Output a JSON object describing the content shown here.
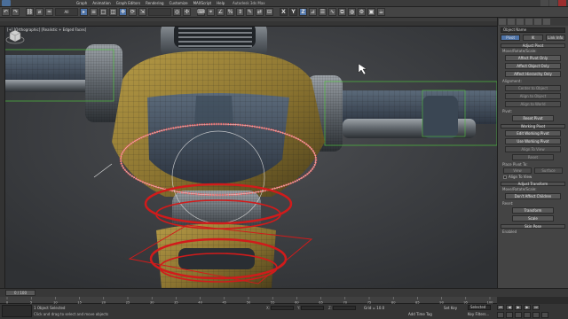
{
  "menubar": {
    "items": [
      "Graph",
      "Animation",
      "Graph Editors",
      "Rendering",
      "Customize",
      "MAXScript",
      "Help"
    ],
    "window_title": "Autodesk 3ds Max"
  },
  "toolbar": {
    "filter": "All",
    "axis_x": "X",
    "axis_y": "Y",
    "axis_z": "Z"
  },
  "viewport": {
    "label": "[+] [Orthographic] [Realistic + Edged Faces]"
  },
  "command_panel": {
    "name_field": "Object Name",
    "tabs": [
      "Pivot",
      "IK",
      "Link Info"
    ],
    "adjust_pivot": {
      "header": "Adjust Pivot",
      "move_rotate_scale": "Move/Rotate/Scale:",
      "btn_pivot_only": "Affect Pivot Only",
      "btn_object_only": "Affect Object Only",
      "btn_hierarchy_only": "Affect Hierarchy Only"
    },
    "alignment": {
      "header": "Alignment:",
      "btn_center": "Center to Object",
      "btn_align": "Align to Object",
      "btn_world": "Align to World"
    },
    "pivot": {
      "header": "Pivot:",
      "btn_reset": "Reset Pivot"
    },
    "working_pivot": {
      "header": "Working Pivot",
      "btn_edit": "Edit Working Pivot",
      "btn_use": "Use Working Pivot",
      "btn_align_view": "Align To View",
      "btn_reset": "Reset",
      "place_label": "Place Pivot To:",
      "btn_view": "View",
      "btn_surface": "Surface",
      "chk_align": "Align To View"
    },
    "adjust_transform": {
      "header": "Adjust Transform",
      "move_rotate_scale": "Move/Rotate/Scale:",
      "btn_dont_affect": "Don't Affect Children",
      "reset_label": "Reset:",
      "btn_transform": "Transform",
      "btn_scale": "Scale"
    },
    "skin_pose": {
      "header": "Skin Pose",
      "enabled": "Enabled"
    }
  },
  "timeline": {
    "slider": "0 / 100",
    "ticks": [
      "0",
      "5",
      "10",
      "15",
      "20",
      "25",
      "30",
      "35",
      "40",
      "45",
      "50",
      "55",
      "60",
      "65",
      "70",
      "75",
      "80",
      "85",
      "90",
      "95",
      "100"
    ]
  },
  "status": {
    "left_box": "",
    "message1": "1 Object Selected",
    "message2": "Click and drag to select and move objects",
    "x_label": "X:",
    "y_label": "Y:",
    "z_label": "Z:",
    "x_value": "",
    "y_value": "",
    "z_value": "",
    "grid": "Grid = 10.0",
    "auto_key": "Selected",
    "add_time_tag": "Add Time Tag",
    "set_key": "Set Key",
    "key_filters": "Key Filters..."
  }
}
